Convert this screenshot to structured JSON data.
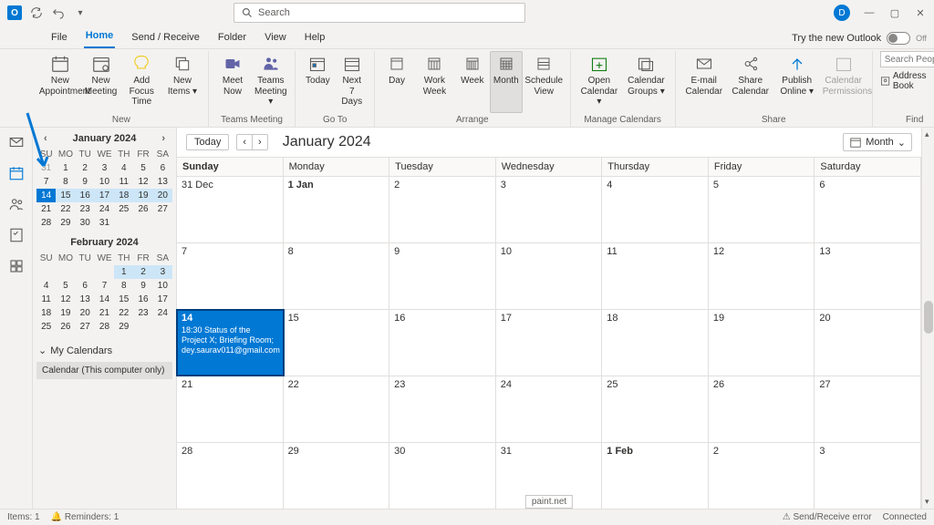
{
  "titlebar": {
    "search_placeholder": "Search",
    "avatar_initial": "D"
  },
  "menu": {
    "file": "File",
    "home": "Home",
    "sendreceive": "Send / Receive",
    "folder": "Folder",
    "view": "View",
    "help": "Help",
    "try_new": "Try the new Outlook",
    "toggle_state": "Off"
  },
  "ribbon": {
    "new_appointment": "New Appointment",
    "new_meeting": "New Meeting",
    "add_focus": "Add Focus Time",
    "new_items": "New Items",
    "group_new": "New",
    "meet_now": "Meet Now",
    "teams_meeting": "Teams Meeting",
    "group_teams": "Teams Meeting",
    "today": "Today",
    "next7": "Next 7 Days",
    "group_goto": "Go To",
    "day": "Day",
    "workweek": "Work Week",
    "week": "Week",
    "month": "Month",
    "sched": "Schedule View",
    "group_arrange": "Arrange",
    "open_cal": "Open Calendar",
    "cal_groups": "Calendar Groups",
    "group_manage": "Manage Calendars",
    "email_cal": "E-mail Calendar",
    "share_cal": "Share Calendar",
    "pub_online": "Publish Online",
    "cal_perm": "Calendar Permissions",
    "group_share": "Share",
    "search_people": "Search People",
    "address_book": "Address Book",
    "group_find": "Find"
  },
  "minical1": {
    "title": "January 2024",
    "dow": [
      "SU",
      "MO",
      "TU",
      "WE",
      "TH",
      "FR",
      "SA"
    ],
    "days": [
      [
        31,
        1,
        2,
        3,
        4,
        5,
        6
      ],
      [
        7,
        8,
        9,
        10,
        11,
        12,
        13
      ],
      [
        14,
        15,
        16,
        17,
        18,
        19,
        20
      ],
      [
        21,
        22,
        23,
        24,
        25,
        26,
        27
      ],
      [
        28,
        29,
        30,
        31,
        "",
        "",
        ""
      ]
    ],
    "dim_first": 1,
    "selected": 14,
    "hl_week": 2
  },
  "minical2": {
    "title": "February 2024",
    "dow": [
      "SU",
      "MO",
      "TU",
      "WE",
      "TH",
      "FR",
      "SA"
    ],
    "days": [
      [
        "",
        "",
        "",
        "",
        1,
        2,
        3
      ],
      [
        4,
        5,
        6,
        7,
        8,
        9,
        10
      ],
      [
        11,
        12,
        13,
        14,
        15,
        16,
        17
      ],
      [
        18,
        19,
        20,
        21,
        22,
        23,
        24
      ],
      [
        25,
        26,
        27,
        28,
        29,
        "",
        ""
      ]
    ],
    "hl_first": 3
  },
  "mycal": {
    "header": "My Calendars",
    "item": "Calendar (This computer only)"
  },
  "main": {
    "today_btn": "Today",
    "title": "January 2024",
    "view": "Month",
    "dow": [
      "Sunday",
      "Monday",
      "Tuesday",
      "Wednesday",
      "Thursday",
      "Friday",
      "Saturday"
    ],
    "weeks": [
      [
        {
          "n": "31 Dec"
        },
        {
          "n": "1 Jan",
          "bold": true
        },
        {
          "n": "2"
        },
        {
          "n": "3"
        },
        {
          "n": "4"
        },
        {
          "n": "5"
        },
        {
          "n": "6"
        }
      ],
      [
        {
          "n": "7"
        },
        {
          "n": "8"
        },
        {
          "n": "9"
        },
        {
          "n": "10"
        },
        {
          "n": "11"
        },
        {
          "n": "12"
        },
        {
          "n": "13"
        }
      ],
      [
        {
          "n": "14",
          "sel": true,
          "evt": "18:30 Status of the Project X; Briefing Room; dey.saurav011@gmail.com"
        },
        {
          "n": "15"
        },
        {
          "n": "16"
        },
        {
          "n": "17"
        },
        {
          "n": "18"
        },
        {
          "n": "19"
        },
        {
          "n": "20"
        }
      ],
      [
        {
          "n": "21"
        },
        {
          "n": "22"
        },
        {
          "n": "23"
        },
        {
          "n": "24"
        },
        {
          "n": "25"
        },
        {
          "n": "26"
        },
        {
          "n": "27"
        }
      ],
      [
        {
          "n": "28"
        },
        {
          "n": "29"
        },
        {
          "n": "30"
        },
        {
          "n": "31"
        },
        {
          "n": "1 Feb",
          "bold": true
        },
        {
          "n": "2"
        },
        {
          "n": "3"
        }
      ]
    ],
    "tooltip": "paint.net"
  },
  "status": {
    "items": "Items: 1",
    "reminders": "Reminders: 1",
    "sr_error": "Send/Receive error",
    "connected": "Connected"
  }
}
